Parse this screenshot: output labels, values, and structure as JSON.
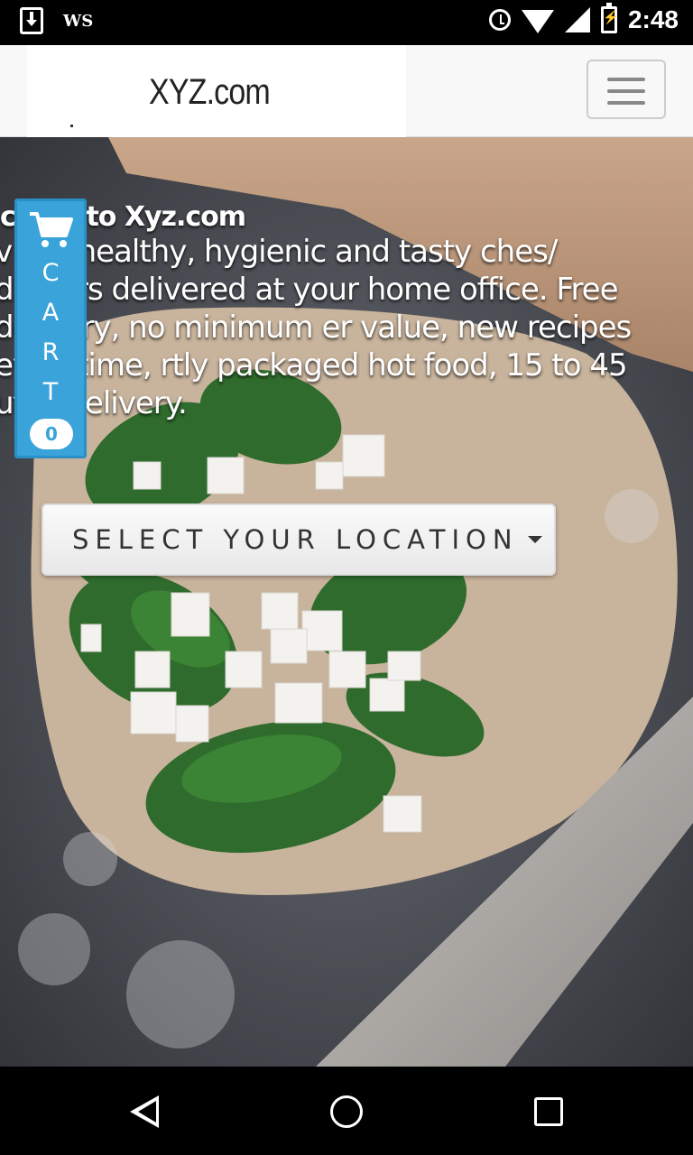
{
  "status_bar": {
    "left_label": "WS",
    "time": "2:48"
  },
  "header": {
    "logo": "XYZ.com",
    "menu_icon": "hamburger-icon"
  },
  "hero": {
    "welcome_title": "come to Xyz.com",
    "welcome_body": "v get healthy, hygienic and tasty ches/ dinners delivered at your home office. Free delivery, no minimum er value, new recipes everytime, rtly packaged hot food, 15 to 45 utes delivery.",
    "location_button": "SELECT YOUR LOCATION"
  },
  "cart": {
    "letters": [
      "C",
      "A",
      "R",
      "T"
    ],
    "count": "0",
    "color": "#3aa3d9"
  },
  "nav_bar": {
    "icons": [
      "back-icon",
      "home-icon",
      "recent-apps-icon"
    ]
  }
}
